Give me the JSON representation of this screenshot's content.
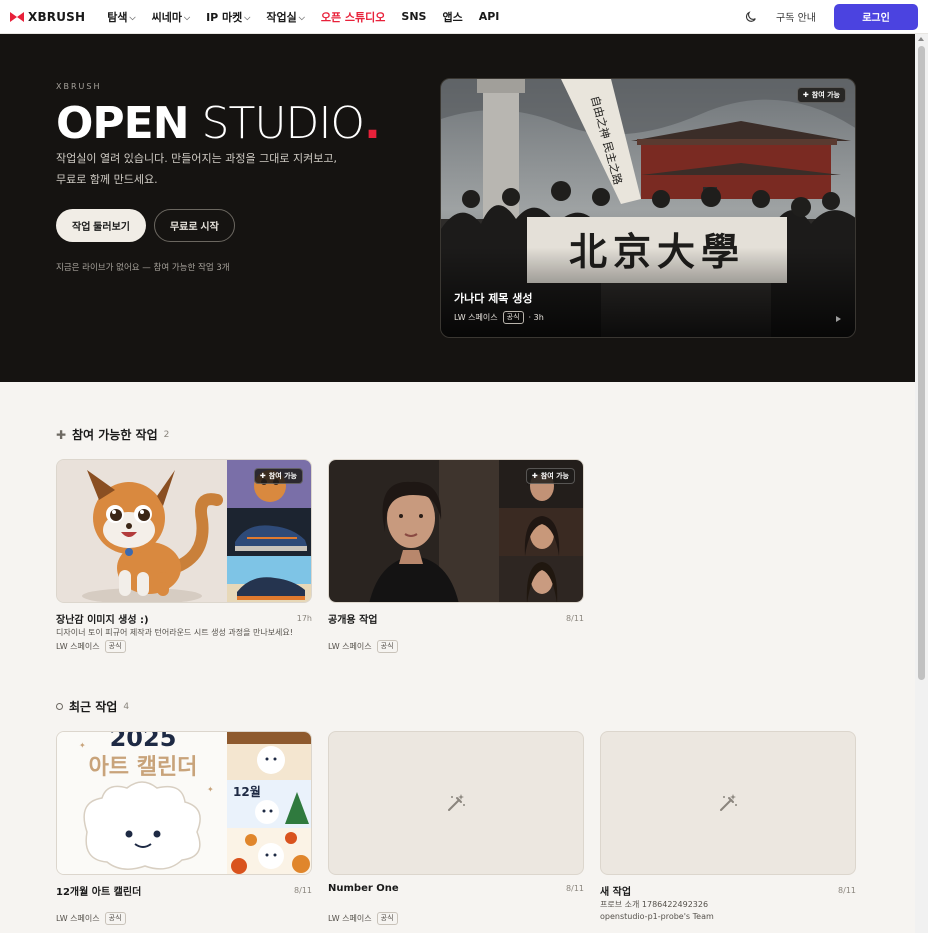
{
  "nav": {
    "logo": "XBRUSH",
    "menu": [
      {
        "label": "탐색",
        "dropdown": true,
        "active": false
      },
      {
        "label": "씨네마",
        "dropdown": true,
        "active": false
      },
      {
        "label": "IP 마켓",
        "dropdown": true,
        "active": false
      },
      {
        "label": "작업실",
        "dropdown": true,
        "active": false
      },
      {
        "label": "오픈 스튜디오",
        "dropdown": false,
        "active": true
      },
      {
        "label": "SNS",
        "dropdown": false,
        "active": false
      },
      {
        "label": "앱스",
        "dropdown": false,
        "active": false
      },
      {
        "label": "API",
        "dropdown": false,
        "active": false
      }
    ],
    "subscription": "구독 안내",
    "login": "로그인"
  },
  "hero": {
    "eyebrow": "XBRUSH",
    "title_bold": "OPEN",
    "title_light": "STUDIO",
    "title_dot": ".",
    "desc_line1": "작업실이 열려 있습니다. 만들어지는 과정을 그대로 지켜보고,",
    "desc_line2": "무료로 함께 만드세요.",
    "btn_browse": "작업 둘러보기",
    "btn_start": "무료로 시작",
    "note": "지금은 라이브가 없어요 — 참여 가능한 작업 3개",
    "featured": {
      "badge": "참여 가능",
      "banner_text": "北京大學",
      "flag_text": "自由之神 民主之路",
      "title": "가나다 제목 생성",
      "author": "LW 스페이스",
      "tag": "공식",
      "time": "· 3h"
    }
  },
  "sections": {
    "joinable": {
      "title": "참여 가능한 작업",
      "count": "2",
      "cards": [
        {
          "title": "장난감 이미지 생성 :)",
          "time": "17h",
          "desc": "디자이너 토이 피규어 제작과 턴어라운드 시트 생성 과정을 만나보세요!",
          "author": "LW 스페이스",
          "tag": "공식",
          "badge": "참여 가능"
        },
        {
          "title": "공개용 작업",
          "time": "8/11",
          "author": "LW 스페이스",
          "tag": "공식",
          "badge": "참여 가능"
        }
      ]
    },
    "recent": {
      "title": "최근 작업",
      "count": "4",
      "cards": [
        {
          "title": "12개월 아트 캘린더",
          "time": "8/11",
          "author": "LW 스페이스",
          "tag": "공식",
          "thumb_year": "2025",
          "thumb_caption": "아트 캘린더",
          "thumb_month": "12월"
        },
        {
          "title": "Number One",
          "time": "8/11",
          "author": "LW 스페이스",
          "tag": "공식"
        },
        {
          "title": "새 작업",
          "time": "8/11",
          "desc": "프로브 소개 1786422492326",
          "team": "openstudio-p1-probe's Team"
        }
      ]
    }
  },
  "icons": {
    "logo": "xbrush-logo-icon",
    "theme": "moon-icon",
    "plus": "plus-icon",
    "empty": "magic-wand-icon"
  },
  "colors": {
    "brand_red": "#e8213a",
    "login_purple": "#4b43e0",
    "hero_bg": "#151311",
    "page_bg": "#f6f4f1"
  }
}
